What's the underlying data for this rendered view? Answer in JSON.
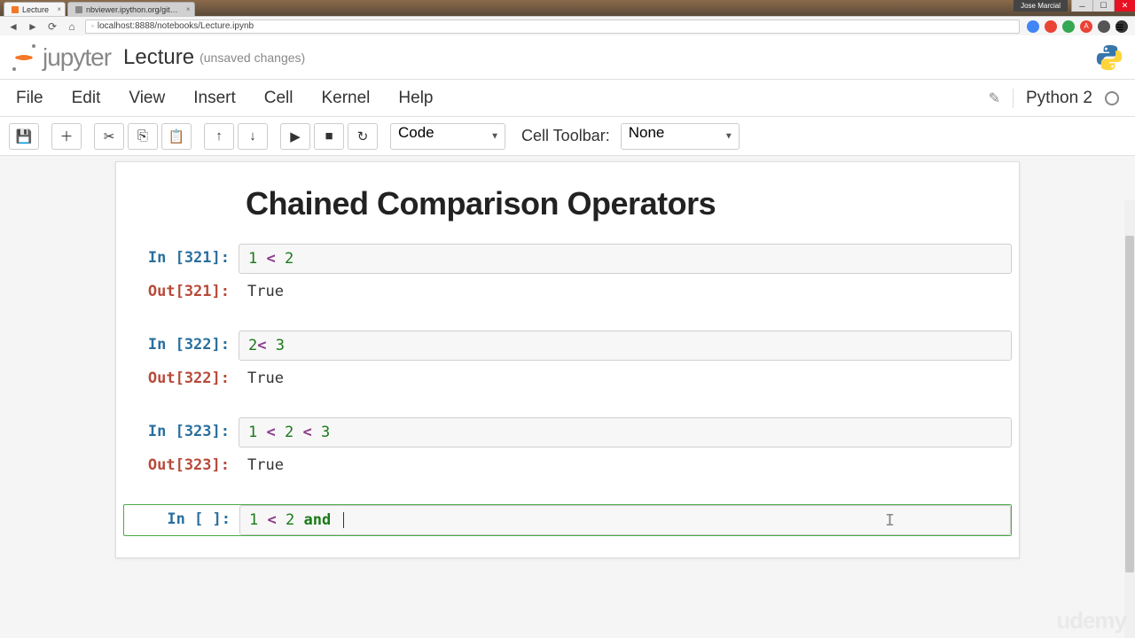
{
  "browser": {
    "tabs": [
      {
        "title": "Lecture",
        "active": true
      },
      {
        "title": "nbviewer.ipython.org/git…",
        "active": false
      }
    ],
    "url": "localhost:8888/notebooks/Lecture.ipynb",
    "user_badge": "Jose Marcial"
  },
  "window_controls": {
    "min": "─",
    "max": "☐",
    "close": "✕"
  },
  "header": {
    "logo_text": "jupyter",
    "notebook_name": "Lecture",
    "status": "(unsaved changes)"
  },
  "menubar": {
    "items": [
      "File",
      "Edit",
      "View",
      "Insert",
      "Cell",
      "Kernel",
      "Help"
    ],
    "kernel_name": "Python 2"
  },
  "toolbar": {
    "cell_type": "Code",
    "cell_toolbar_label": "Cell Toolbar:",
    "cell_toolbar_value": "None"
  },
  "cells": {
    "heading": "Chained Comparison Operators",
    "c1": {
      "in_prompt": "In [321]:",
      "in_code": {
        "n1": "1",
        "op": "<",
        "n2": "2"
      },
      "out_prompt": "Out[321]:",
      "out_text": "True"
    },
    "c2": {
      "in_prompt": "In [322]:",
      "in_code": {
        "n1": "2",
        "op": "<",
        "sp": "",
        "n2": "3"
      },
      "out_prompt": "Out[322]:",
      "out_text": "True"
    },
    "c3": {
      "in_prompt": "In [323]:",
      "in_code": {
        "n1": "1",
        "op1": "<",
        "n2": "2",
        "op2": "<",
        "n3": "3"
      },
      "out_prompt": "Out[323]:",
      "out_text": "True"
    },
    "c4": {
      "in_prompt": "In [ ]:",
      "in_code": {
        "n1": "1",
        "op": "<",
        "n2": "2",
        "kw": "and"
      }
    }
  },
  "watermark": "udemy"
}
